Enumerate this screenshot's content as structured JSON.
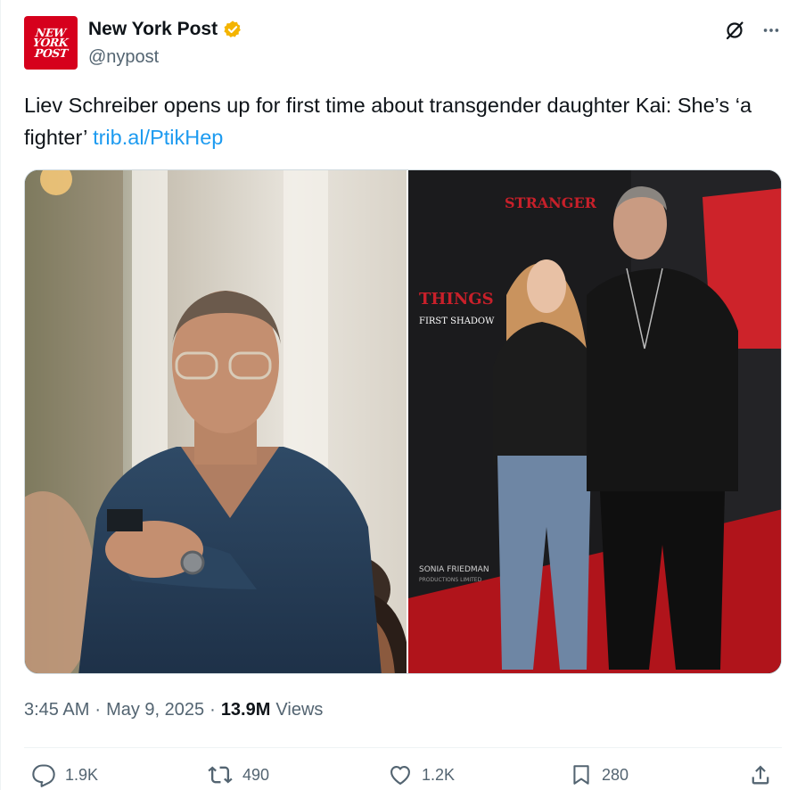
{
  "author": {
    "avatar_text": [
      "NEW",
      "YORK",
      "POST"
    ],
    "display_name": "New York Post",
    "handle": "@nypost",
    "verified": true,
    "verified_color": "#f4b400"
  },
  "tweet": {
    "text": "Liev Schreiber opens up for first time about transgender daughter Kai: She’s ‘a fighter’",
    "link": "trib.al/PtikHep"
  },
  "media": {
    "images": [
      {
        "name": "left-photo"
      },
      {
        "name": "right-photo",
        "backdrop_text": [
          "STRANGER",
          "THINGS",
          "FIRST SHADOW",
          "SONIA FRIEDMAN",
          "PRODUCTIONS LIMITED"
        ]
      }
    ]
  },
  "meta": {
    "time": "3:45 AM",
    "dot1": "·",
    "date": "May 9, 2025",
    "dot2": "·",
    "views_count": "13.9M",
    "views_label": "Views"
  },
  "actions": {
    "replies": "1.9K",
    "reposts": "490",
    "likes": "1.2K",
    "bookmarks": "280"
  },
  "colors": {
    "brand_red": "#d6001c",
    "link": "#1d9bf0",
    "muted": "#536471"
  }
}
